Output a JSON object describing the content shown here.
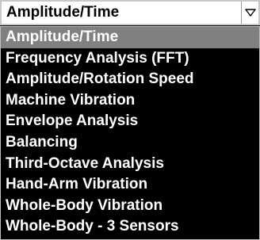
{
  "dropdown": {
    "selected_value": "Amplitude/Time",
    "arrow_icon": "triangle-down-icon",
    "options": [
      {
        "label": "Amplitude/Time",
        "selected": true
      },
      {
        "label": "Frequency Analysis (FFT)",
        "selected": false
      },
      {
        "label": "Amplitude/Rotation Speed",
        "selected": false
      },
      {
        "label": "Machine Vibration",
        "selected": false
      },
      {
        "label": "Envelope Analysis",
        "selected": false
      },
      {
        "label": "Balancing",
        "selected": false
      },
      {
        "label": "Third-Octave Analysis",
        "selected": false
      },
      {
        "label": "Hand-Arm Vibration",
        "selected": false
      },
      {
        "label": "Whole-Body Vibration",
        "selected": false
      },
      {
        "label": "Whole-Body - 3 Sensors",
        "selected": false
      }
    ]
  },
  "colors": {
    "list_background": "#000000",
    "list_text": "#ffffff",
    "highlight": "#808080",
    "select_background": "#ffffff",
    "select_text": "#000000"
  }
}
